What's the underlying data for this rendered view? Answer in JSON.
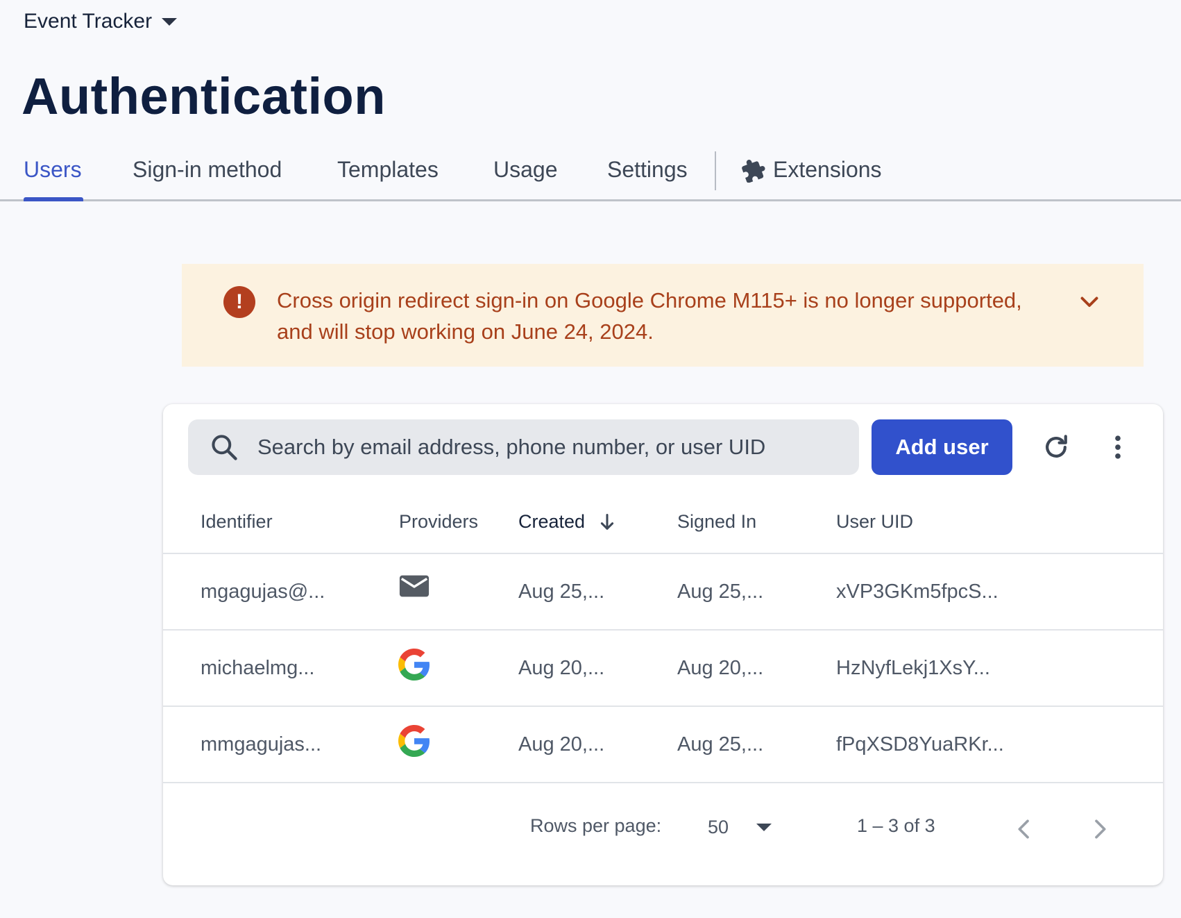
{
  "header": {
    "project_name": "Event Tracker",
    "page_title": "Authentication"
  },
  "tabs": [
    {
      "label": "Users",
      "active": true
    },
    {
      "label": "Sign-in method",
      "active": false
    },
    {
      "label": "Templates",
      "active": false
    },
    {
      "label": "Usage",
      "active": false
    },
    {
      "label": "Settings",
      "active": false
    },
    {
      "label": "Extensions",
      "active": false,
      "icon": "puzzle-icon"
    }
  ],
  "banner": {
    "icon": "error-icon",
    "text": "Cross origin redirect sign-in on Google Chrome M115+ is no longer supported, and will stop working on June 24, 2024.",
    "color": "#a8401b",
    "background": "#fcf2e0"
  },
  "toolbar": {
    "search_placeholder": "Search by email address, phone number, or user UID",
    "add_user_label": "Add user",
    "accent_color": "#3151cc"
  },
  "table": {
    "columns": [
      "Identifier",
      "Providers",
      "Created",
      "Signed In",
      "User UID"
    ],
    "sorted_column": "Created",
    "sort_direction": "descending",
    "rows": [
      {
        "identifier": "mgagujas@...",
        "provider": "email-icon",
        "created": "Aug 25,...",
        "signed_in": "Aug 25,...",
        "uid": "xVP3GKm5fpcS..."
      },
      {
        "identifier": "michaelmg...",
        "provider": "google-icon",
        "created": "Aug 20,...",
        "signed_in": "Aug 20,...",
        "uid": "HzNyfLekj1XsY..."
      },
      {
        "identifier": "mmgagujas...",
        "provider": "google-icon",
        "created": "Aug 20,...",
        "signed_in": "Aug 25,...",
        "uid": "fPqXSD8YuaRKr..."
      }
    ]
  },
  "pagination": {
    "rows_per_page_label": "Rows per page:",
    "rows_per_page_value": "50",
    "range_text": "1 – 3 of 3"
  }
}
